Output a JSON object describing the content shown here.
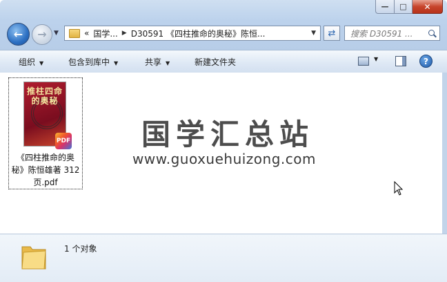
{
  "window": {
    "caption_buttons": {
      "minimize": "—",
      "maximize": "□",
      "close": "✕"
    }
  },
  "nav": {
    "back_icon": "back-arrow-icon",
    "forward_icon": "forward-arrow-icon",
    "breadcrumb_overflow": "«",
    "breadcrumb": [
      "国学...",
      "D30591 《四柱推命的奥秘》陈恒..."
    ],
    "search_placeholder": "搜索 D30591 ..."
  },
  "toolbar": {
    "organize": "组织",
    "include_in_library": "包含到库中",
    "share": "共享",
    "new_folder": "新建文件夹"
  },
  "content": {
    "files": [
      {
        "name": "《四柱推命的奥秘》陈恒雄著 312页.pdf",
        "name_lines": [
          "《四柱推命的奥",
          "秘》陈恒雄著 312",
          "页.pdf"
        ],
        "cover_text": "推柱四命的奥秘",
        "badge": "PDF"
      }
    ],
    "watermark_title": "国学汇总站",
    "watermark_url": "www.guoxuehuizong.com"
  },
  "details": {
    "status": "1 个对象"
  },
  "colors": {
    "accent": "#2c6fc2",
    "close_red": "#c7452c",
    "frame": "#bcd2ec"
  }
}
